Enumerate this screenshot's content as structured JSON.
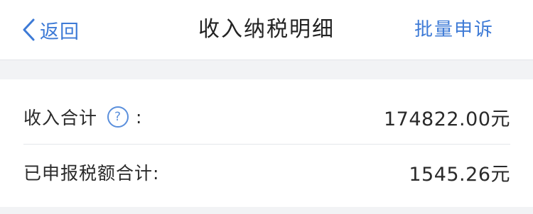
{
  "nav": {
    "back_label": "返回",
    "title": "收入纳税明细",
    "action_label": "批量申诉"
  },
  "summary": {
    "income_total_label": "收入合计",
    "income_total_colon": ":",
    "help_icon_glyph": "?",
    "income_total_value": "174822.00元",
    "tax_total_label": "已申报税额合计:",
    "tax_total_value": "1545.26元"
  },
  "colors": {
    "accent": "#3d7ad6",
    "background": "#f2f3f5",
    "card": "#ffffff"
  }
}
